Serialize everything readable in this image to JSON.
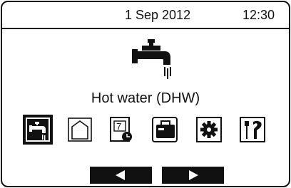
{
  "status": {
    "date": "1 Sep 2012",
    "time": "12:30"
  },
  "screen": {
    "title": "Hot water (DHW)",
    "hero_icon": "water-tap-icon"
  },
  "menu": [
    {
      "icon": "water-tap-icon",
      "selected": true
    },
    {
      "icon": "house-icon",
      "selected": false
    },
    {
      "icon": "calendar-clock-icon",
      "selected": false
    },
    {
      "icon": "suitcase-icon",
      "selected": false
    },
    {
      "icon": "gear-icon",
      "selected": false
    },
    {
      "icon": "service-tools-icon",
      "selected": false
    }
  ],
  "nav": {
    "prev_icon": "left-arrow-icon",
    "next_icon": "right-arrow-icon"
  }
}
